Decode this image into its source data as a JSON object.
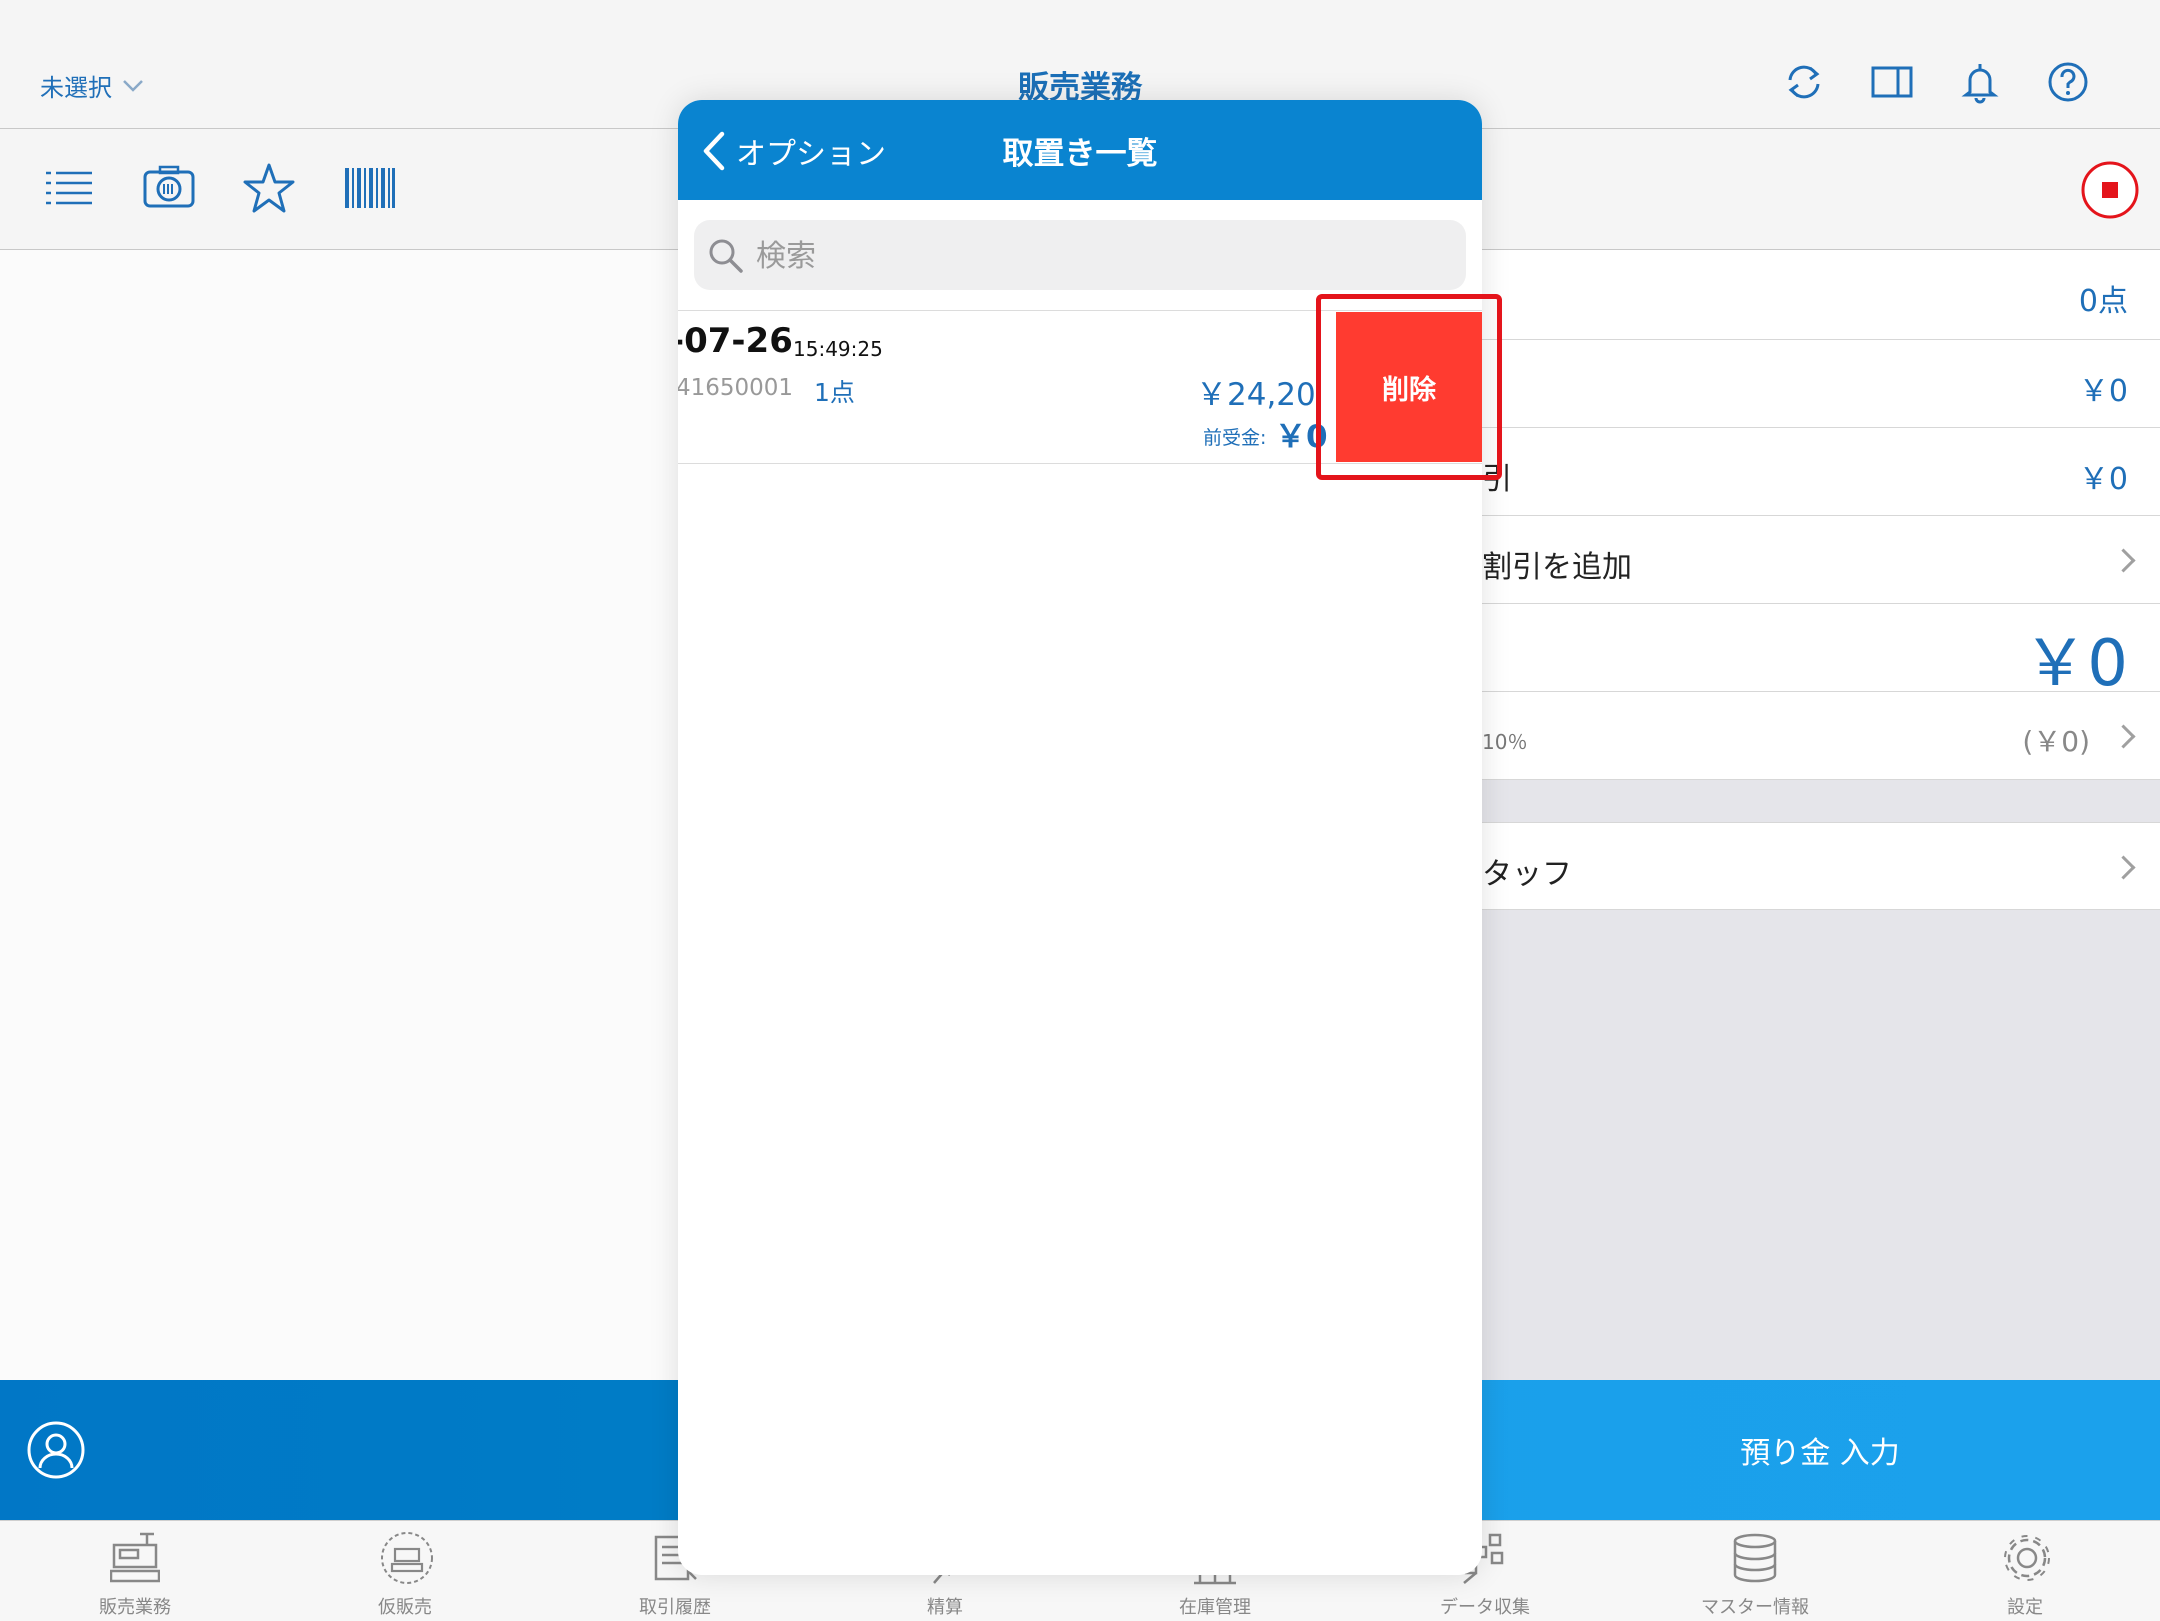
{
  "header": {
    "store": "未選択",
    "title": "販売業務"
  },
  "summary": {
    "item_count": "0点",
    "subtotal": "￥0",
    "discount_label": "引",
    "discount": "￥0",
    "add_discount": "割引を追加",
    "total": "￥0",
    "tax_rate": "10％",
    "tax": "(￥0)",
    "staff": "タッフ"
  },
  "action": {
    "deposit": "預り金 入力"
  },
  "modal": {
    "back": "オプション",
    "title": "取置き一覧",
    "search_placeholder": "検索",
    "item": {
      "date": "-07-26",
      "time": "15:49:25",
      "number": "41650001",
      "count": "1点",
      "amount": "￥24,20",
      "prepaid_label": "前受金:",
      "prepaid": "￥0"
    },
    "delete": "削除"
  },
  "tabs": [
    {
      "label": "販売業務"
    },
    {
      "label": "仮販売"
    },
    {
      "label": "取引履歴"
    },
    {
      "label": "精算"
    },
    {
      "label": "在庫管理"
    },
    {
      "label": "データ収集"
    },
    {
      "label": "マスター情報"
    },
    {
      "label": "設定"
    }
  ],
  "colors": {
    "accent": "#0a84d0",
    "delete": "#ff3b30",
    "highlight": "#e4141b"
  }
}
